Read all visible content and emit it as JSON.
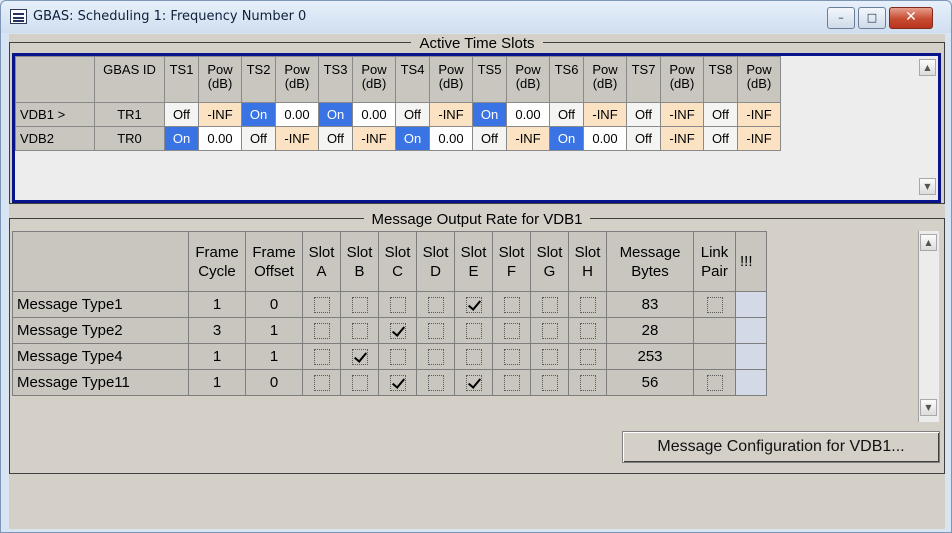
{
  "window": {
    "title": "GBAS: Scheduling 1: Frequency Number 0",
    "minimize_glyph": "–",
    "maximize_glyph": "□",
    "close_glyph": "✕"
  },
  "active_time_slots": {
    "legend": "Active Time Slots",
    "headers": {
      "gbas_id": "GBAS ID",
      "ts": [
        "TS1",
        "TS2",
        "TS3",
        "TS4",
        "TS5",
        "TS6",
        "TS7",
        "TS8"
      ],
      "pow": "Pow (dB)"
    },
    "rows": [
      {
        "label": "VDB1 >",
        "gbas_id": "TR1",
        "slots": [
          {
            "state": "Off",
            "pow": "-INF"
          },
          {
            "state": "On",
            "pow": "0.00"
          },
          {
            "state": "On",
            "pow": "0.00"
          },
          {
            "state": "Off",
            "pow": "-INF"
          },
          {
            "state": "On",
            "pow": "0.00"
          },
          {
            "state": "Off",
            "pow": "-INF"
          },
          {
            "state": "Off",
            "pow": "-INF"
          },
          {
            "state": "Off",
            "pow": "-INF"
          }
        ]
      },
      {
        "label": "VDB2",
        "gbas_id": "TR0",
        "slots": [
          {
            "state": "On",
            "pow": "0.00"
          },
          {
            "state": "Off",
            "pow": "-INF"
          },
          {
            "state": "Off",
            "pow": "-INF"
          },
          {
            "state": "On",
            "pow": "0.00"
          },
          {
            "state": "Off",
            "pow": "-INF"
          },
          {
            "state": "On",
            "pow": "0.00"
          },
          {
            "state": "Off",
            "pow": "-INF"
          },
          {
            "state": "Off",
            "pow": "-INF"
          }
        ]
      }
    ]
  },
  "message_output_rate": {
    "legend": "Message Output Rate for VDB1",
    "headers": {
      "frame_cycle": "Frame Cycle",
      "frame_offset": "Frame Offset",
      "slots": [
        "Slot A",
        "Slot B",
        "Slot C",
        "Slot D",
        "Slot E",
        "Slot F",
        "Slot G",
        "Slot H"
      ],
      "message_bytes": "Message Bytes",
      "link_pair": "Link Pair",
      "extra": "!!!"
    },
    "rows": [
      {
        "label": "Message Type1",
        "frame_cycle": "1",
        "frame_offset": "0",
        "slots": [
          false,
          false,
          false,
          false,
          true,
          false,
          false,
          false
        ],
        "bytes": "83",
        "link_pair": "checkbox"
      },
      {
        "label": "Message Type2",
        "frame_cycle": "3",
        "frame_offset": "1",
        "slots": [
          false,
          false,
          true,
          false,
          false,
          false,
          false,
          false
        ],
        "bytes": "28",
        "link_pair": "none"
      },
      {
        "label": "Message Type4",
        "frame_cycle": "1",
        "frame_offset": "1",
        "slots": [
          false,
          true,
          false,
          false,
          false,
          false,
          false,
          false
        ],
        "bytes": "253",
        "link_pair": "none"
      },
      {
        "label": "Message Type11",
        "frame_cycle": "1",
        "frame_offset": "0",
        "slots": [
          false,
          false,
          true,
          false,
          true,
          false,
          false,
          false
        ],
        "bytes": "56",
        "link_pair": "checkbox"
      }
    ],
    "config_button": "Message Configuration for VDB1..."
  },
  "colors": {
    "on_cell": "#3a74e4",
    "off_cell": "#f4f4f2",
    "inf_pow_cell": "#fbe2c2",
    "active_frame": "#08148a"
  }
}
